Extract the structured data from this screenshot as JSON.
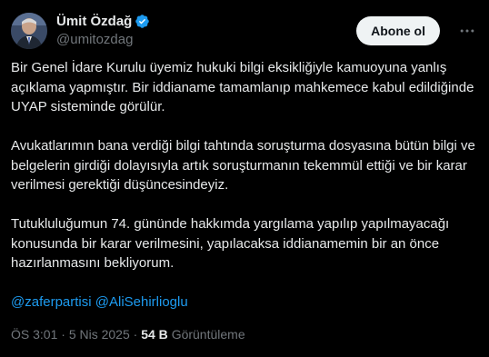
{
  "author": {
    "display_name": "Ümit Özdağ",
    "handle": "@umitozdag",
    "verified": true
  },
  "actions": {
    "follow_label": "Abone ol",
    "more_icon": "more-horizontal-icon"
  },
  "tweet": {
    "paragraphs": [
      "Bir Genel İdare Kurulu üyemiz hukuki bilgi eksikliğiyle kamuoyuna yanlış açıklama yapmıştır. Bir iddianame tamamlanıp mahkemece kabul edildiğinde UYAP sisteminde görülür.",
      "Avukatlarımın bana verdiği bilgi tahtında soruşturma dosyasına bütün bilgi ve belgelerin girdiği dolayısıyla artık soruşturmanın tekemmül ettiği ve bir karar verilmesi gerektiği düşüncesindeyiz.",
      "Tutukluluğumun 74. gününde hakkımda yargılama yapılıp yapılmayacağı konusunda bir karar verilmesini, yapılacaksa iddianamemin bir an önce hazırlanmasını bekliyorum."
    ],
    "mentions": [
      "@zaferpartisi",
      "@AliSehirlioglu"
    ]
  },
  "meta": {
    "time": "ÖS 3:01",
    "separator": "·",
    "date": "5 Nis 2025",
    "views_count": "54 B",
    "views_label": "Görüntüleme"
  },
  "colors": {
    "background": "#000000",
    "text": "#e7e9ea",
    "secondary": "#71767b",
    "link": "#1d9bf0",
    "verified": "#1d9bf0",
    "button_bg": "#eff3f4"
  }
}
